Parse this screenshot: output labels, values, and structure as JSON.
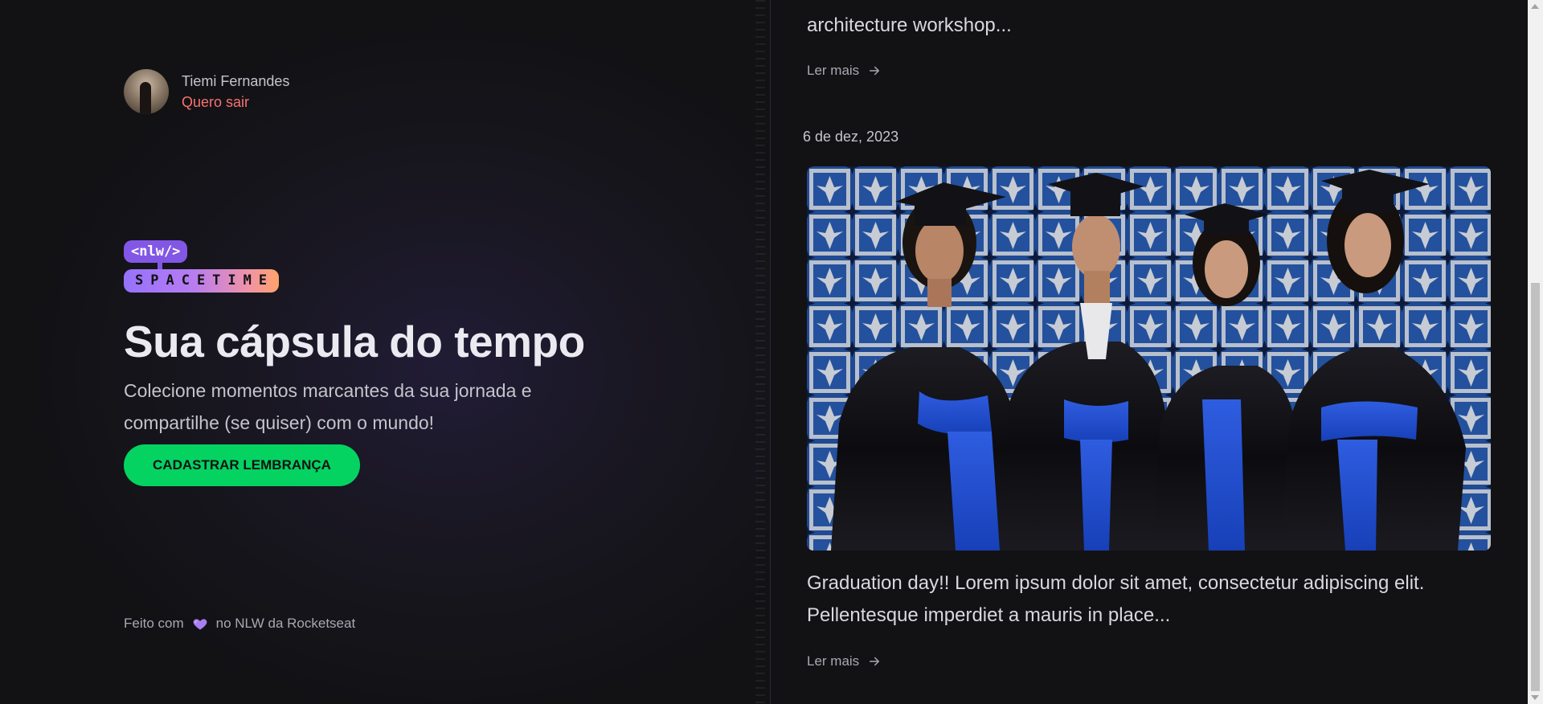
{
  "user": {
    "name": "Tiemi Fernandes",
    "logout_label": "Quero sair"
  },
  "logo": {
    "top_text": "<nlw/>",
    "bottom_text": "SPACETIME"
  },
  "hero": {
    "title": "Sua cápsula do tempo",
    "subtitle": "Colecione momentos marcantes da sua jornada e compartilhe (se quiser) com o mundo!",
    "cta_label": "CADASTRAR LEMBRANÇA"
  },
  "footer": {
    "prefix": "Feito com",
    "suffix": "no NLW da Rocketseat",
    "icon": "heart-icon"
  },
  "memories": [
    {
      "excerpt": "architecture workshop...",
      "read_more": "Ler mais"
    },
    {
      "date": "6 de dez, 2023",
      "image_alt": "Graduation photo",
      "excerpt": "Graduation day!! Lorem ipsum dolor sit amet, consectetur adipiscing elit. Pellentesque imperdiet a mauris in place...",
      "read_more": "Ler mais"
    }
  ],
  "colors": {
    "accent_green": "#04d361",
    "logout_red": "#f87171",
    "brand_purple": "#8257e5",
    "background": "#121215"
  }
}
